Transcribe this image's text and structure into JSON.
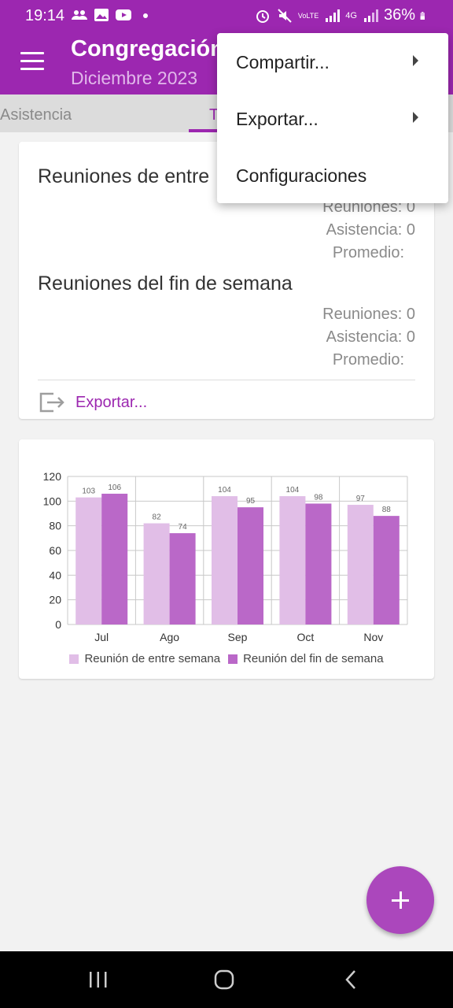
{
  "status_bar": {
    "time": "19:14",
    "volte_label": "VoLTE",
    "network_label": "4G",
    "battery": "36%"
  },
  "app_bar": {
    "title": "Congregación",
    "subtitle": "Diciembre 2023"
  },
  "tabs": [
    {
      "label": "Asistencia"
    },
    {
      "label": "T"
    }
  ],
  "summary": {
    "sections": [
      {
        "title": "Reuniones de entre",
        "reuniones": "Reuniones: 0",
        "asistencia": "Asistencia: 0",
        "promedio": "Promedio:"
      },
      {
        "title": "Reuniones del fin de semana",
        "reuniones": "Reuniones: 0",
        "asistencia": "Asistencia: 0",
        "promedio": "Promedio:"
      }
    ],
    "export_label": "Exportar..."
  },
  "menu": {
    "items": [
      {
        "label": "Compartir...",
        "submenu": true
      },
      {
        "label": "Exportar...",
        "submenu": true
      },
      {
        "label": "Configuraciones",
        "submenu": false
      }
    ]
  },
  "colors": {
    "primary": "#9c27b0",
    "series_weekday": "#e1bee7",
    "series_weekend": "#ba68c8",
    "fab": "#ab47bc"
  },
  "chart_data": {
    "type": "bar",
    "categories": [
      "Jul",
      "Ago",
      "Sep",
      "Oct",
      "Nov"
    ],
    "series": [
      {
        "name": "Reunión de entre semana",
        "values": [
          103,
          82,
          104,
          104,
          97
        ]
      },
      {
        "name": "Reunión del fin de semana",
        "values": [
          106,
          74,
          95,
          98,
          88
        ]
      }
    ],
    "ylim": [
      0,
      120
    ],
    "yticks": [
      0,
      20,
      40,
      60,
      80,
      100,
      120
    ],
    "grid": true,
    "legend_position": "bottom"
  },
  "fab": {
    "icon": "plus-icon"
  }
}
